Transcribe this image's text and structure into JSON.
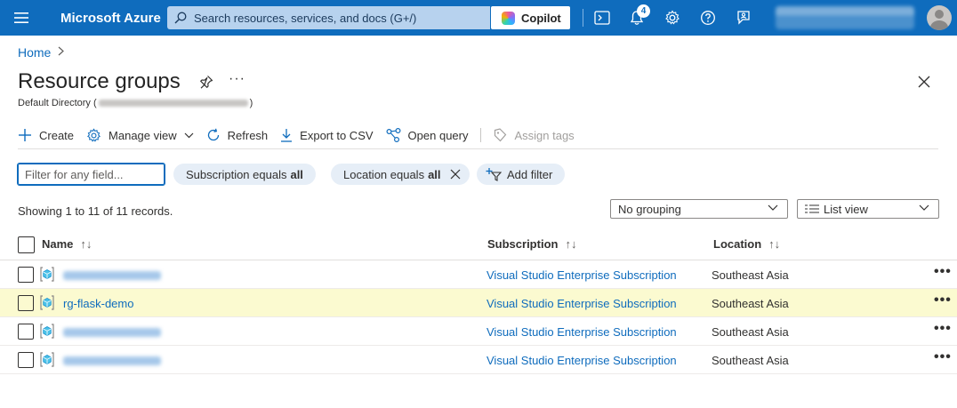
{
  "topbar": {
    "brand": "Microsoft Azure",
    "search_placeholder": "Search resources, services, and docs (G+/)",
    "copilot_label": "Copilot",
    "notification_count": "4",
    "colors": {
      "bar": "#0f6cbd",
      "link": "#0f6cbd"
    }
  },
  "breadcrumb": {
    "home": "Home"
  },
  "header": {
    "title": "Resource groups",
    "subtitle_prefix": "Default Directory (",
    "subtitle_suffix": ")",
    "more": "···"
  },
  "toolbar": {
    "create": "Create",
    "manage_view": "Manage view",
    "refresh": "Refresh",
    "export_csv": "Export to CSV",
    "open_query": "Open query",
    "assign_tags": "Assign tags"
  },
  "filters": {
    "search_placeholder": "Filter for any field...",
    "subscription_prefix": "Subscription equals",
    "subscription_value": "all",
    "location_prefix": "Location equals",
    "location_value": "all",
    "add_filter": "Add filter"
  },
  "records_text": "Showing 1 to 11 of 11 records.",
  "grouping": {
    "selected": "No grouping"
  },
  "view_mode": {
    "selected": "List view"
  },
  "table": {
    "columns": [
      "Name",
      "Subscription",
      "Location"
    ],
    "sort_glyph": "↑↓",
    "rows": [
      {
        "name": "",
        "name_obscured": true,
        "subscription": "Visual Studio Enterprise Subscription",
        "location": "Southeast Asia",
        "highlighted": false
      },
      {
        "name": "rg-flask-demo",
        "name_obscured": false,
        "subscription": "Visual Studio Enterprise Subscription",
        "location": "Southeast Asia",
        "highlighted": true
      },
      {
        "name": "",
        "name_obscured": true,
        "subscription": "Visual Studio Enterprise Subscription",
        "location": "Southeast Asia",
        "highlighted": false
      },
      {
        "name": "",
        "name_obscured": true,
        "subscription": "Visual Studio Enterprise Subscription",
        "location": "Southeast Asia",
        "highlighted": false
      }
    ],
    "row_menu_glyph": "•••"
  }
}
